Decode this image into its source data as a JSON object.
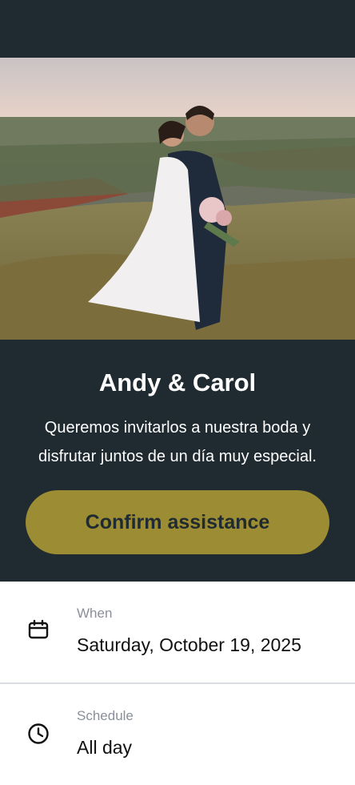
{
  "hero": {
    "couple": "Andy & Carol",
    "message": "Queremos invitarlos a nuestra boda y disfrutar juntos de un día muy especial.",
    "cta_label": "Confirm assistance"
  },
  "details": {
    "when": {
      "label": "When",
      "value": "Saturday, October 19, 2025",
      "icon": "calendar-icon"
    },
    "schedule": {
      "label": "Schedule",
      "value": "All day",
      "icon": "clock-icon"
    }
  },
  "colors": {
    "dark": "#1f2b30",
    "accent": "#9c8c33",
    "muted": "#8a8f99"
  }
}
